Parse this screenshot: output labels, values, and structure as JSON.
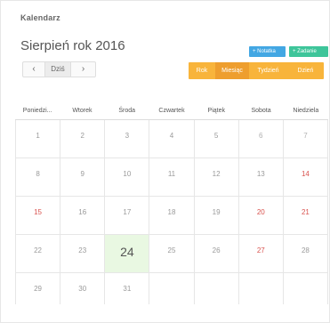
{
  "panel": {
    "title": "Kalendarz"
  },
  "header": {
    "month_title": "Sierpień rok 2016",
    "note_button": "+ Notatka",
    "task_button": "+ Zadanie"
  },
  "nav": {
    "prev": "‹",
    "today": "Dziś",
    "next": "›"
  },
  "views": {
    "rok": "Rok",
    "miesiac": "Miesiąc",
    "tydzien": "Tydzień",
    "dzien": "Dzień",
    "active": "Miesiąc"
  },
  "colors": {
    "note_button": "#43a7e3",
    "task_button": "#3ec59a",
    "view_group": "#f8b43b",
    "view_active": "#ee9e2e",
    "today_cell": "#e9f8e2",
    "sunday_text": "#d9534f"
  },
  "calendar": {
    "weekdays": [
      "Poniedzi...",
      "Wtorek",
      "Środa",
      "Czwartek",
      "Piątek",
      "Sobota",
      "Niedziela"
    ],
    "today": "24",
    "weeks": [
      [
        "1",
        "2",
        "3",
        "4",
        "5",
        "6",
        "7"
      ],
      [
        "8",
        "9",
        "10",
        "11",
        "12",
        "13",
        "14"
      ],
      [
        "15",
        "16",
        "17",
        "18",
        "19",
        "20",
        "21"
      ],
      [
        "22",
        "23",
        "24",
        "25",
        "26",
        "27",
        "28"
      ],
      [
        "29",
        "30",
        "31",
        "",
        "",
        "",
        ""
      ]
    ]
  }
}
